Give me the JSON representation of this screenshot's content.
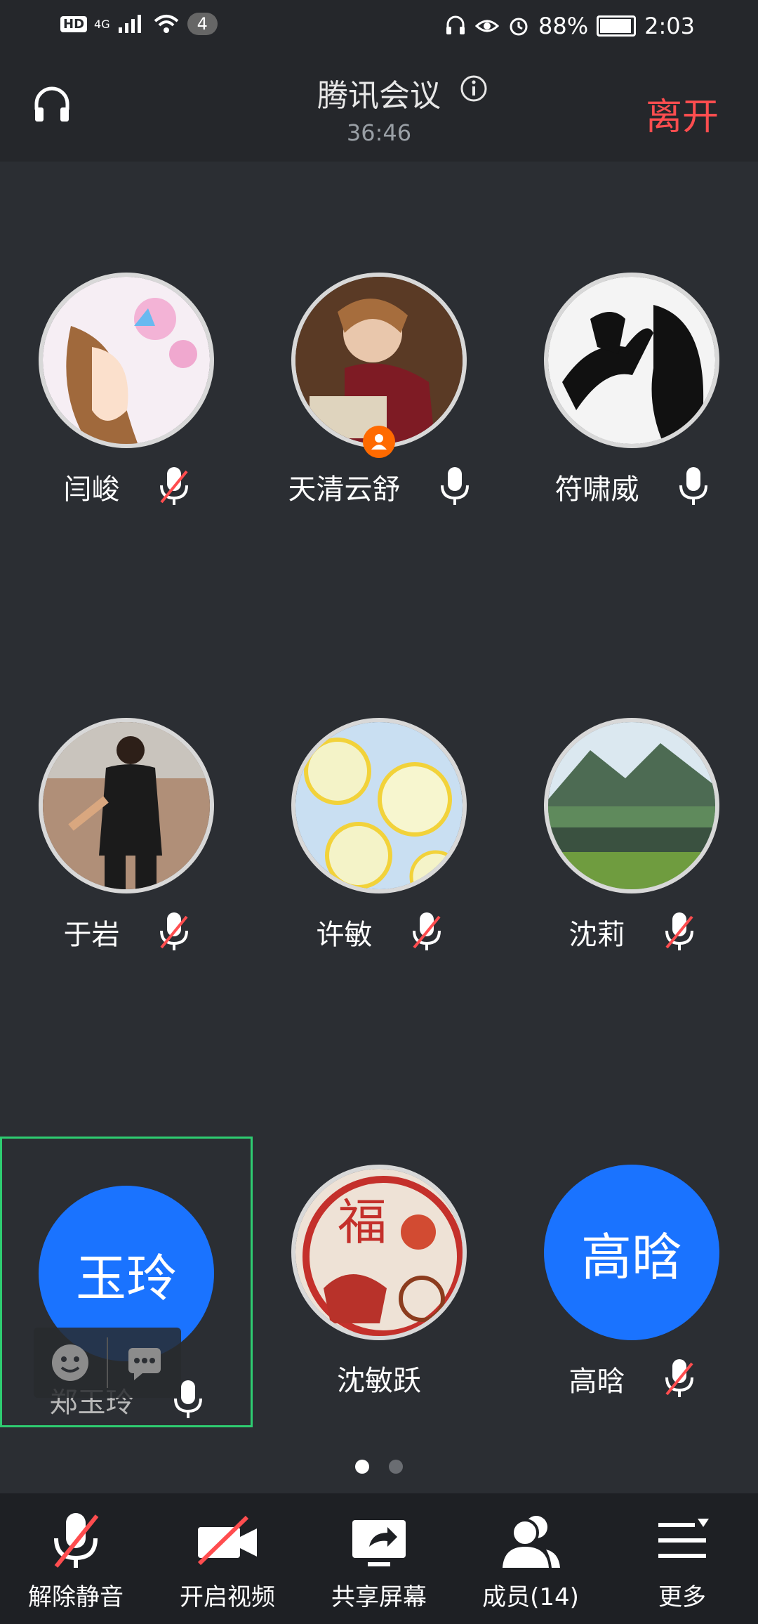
{
  "status": {
    "hd": "HD",
    "network": "4G",
    "notif_count": "4",
    "battery": "88%",
    "time": "2:03",
    "battery_level": 0.88
  },
  "header": {
    "title": "腾讯会议",
    "timer": "36:46",
    "leave": "离开"
  },
  "participants": [
    {
      "name": "闫峻",
      "mic": "muted",
      "avatar": "image"
    },
    {
      "name": "天清云舒",
      "mic": "on",
      "avatar": "image",
      "host": true
    },
    {
      "name": "符啸威",
      "mic": "on",
      "avatar": "image"
    },
    {
      "name": "于岩",
      "mic": "muted",
      "avatar": "image"
    },
    {
      "name": "许敏",
      "mic": "muted",
      "avatar": "image"
    },
    {
      "name": "沈莉",
      "mic": "muted",
      "avatar": "image"
    },
    {
      "name": "郑玉玲",
      "mic": "on",
      "avatar": "text",
      "avatar_text": "玉玲",
      "selected": true
    },
    {
      "name": "沈敏跃",
      "mic": "none",
      "avatar": "image"
    },
    {
      "name": "高晗",
      "mic": "muted",
      "avatar": "text",
      "avatar_text": "高晗"
    }
  ],
  "pagination": {
    "pages": 2,
    "current": 1
  },
  "toolbar": {
    "unmute": "解除静音",
    "video": "开启视频",
    "share": "共享屏幕",
    "members": "成员(14)",
    "more": "更多"
  },
  "colors": {
    "accent": "#1a73ff",
    "leave": "#ff4d4f",
    "selected": "#2ecc71",
    "muted_slash": "#ff4d4f"
  }
}
